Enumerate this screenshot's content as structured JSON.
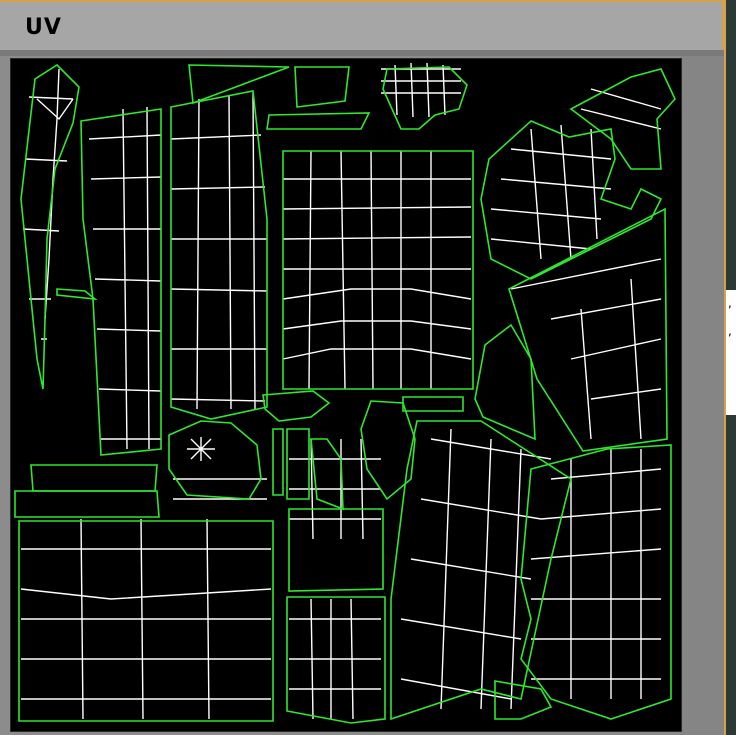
{
  "window": {
    "title": "UV"
  },
  "colors": {
    "island_outline": "#2ee82e",
    "mesh_lines": "#ffffff",
    "canvas_background": "#000000",
    "title_accent": "#d4a24c"
  },
  "side_text": {
    "mark1": ",",
    "mark2": ","
  }
}
